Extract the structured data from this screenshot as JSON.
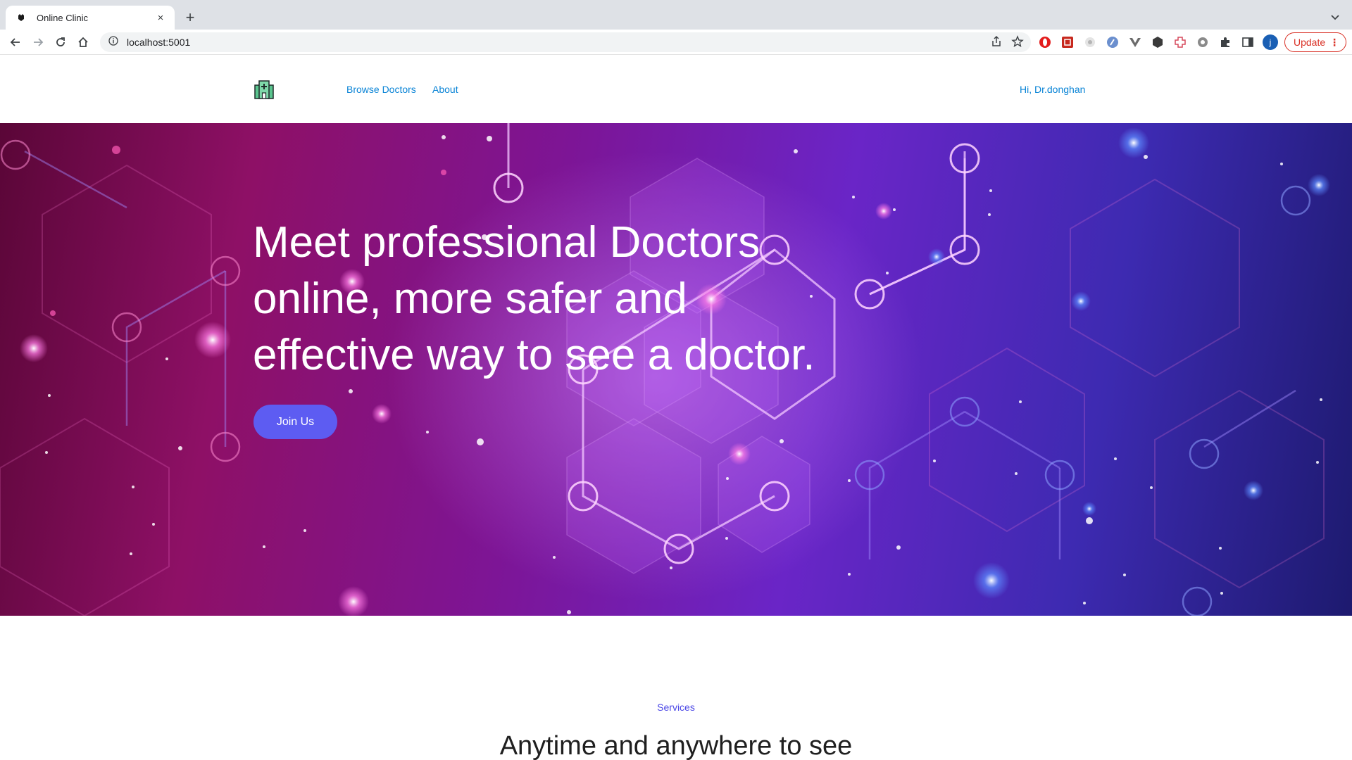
{
  "browser": {
    "tab_title": "Online Clinic",
    "tab_close": "×",
    "new_tab": "+",
    "url": "localhost:5001",
    "update_label": "Update",
    "profile_initial": "j",
    "accent_update": "#d93025"
  },
  "site": {
    "nav": {
      "browse_doctors": "Browse Doctors",
      "about": "About",
      "greeting": "Hi, Dr.donghan",
      "link_color": "#0a84d6"
    },
    "hero": {
      "title": "Meet professional Doctors online, more safer and effective way to see a doctor.",
      "cta": "Join Us",
      "cta_color": "#5d5cf2"
    },
    "services": {
      "eyebrow": "Services",
      "heading": "Anytime and anywhere to see"
    }
  }
}
